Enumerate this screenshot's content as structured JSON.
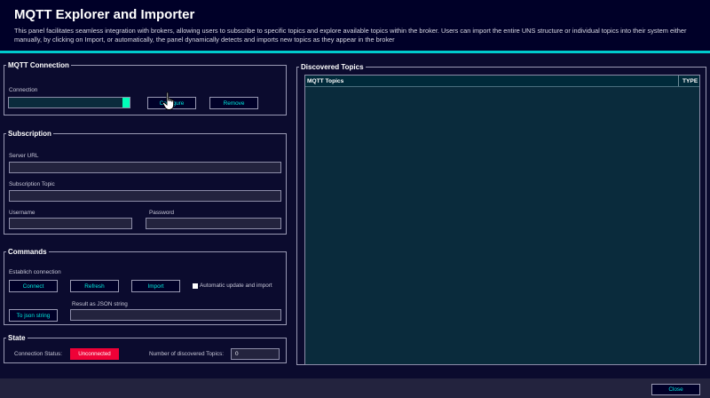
{
  "header": {
    "title": "MQTT Explorer and Importer",
    "description": "This panel facilitates seamless integration with brokers, allowing users to subscribe to specific topics and explore available topics within the broker. Users can import the entire UNS structure or individual topics into their system either manually, by clicking on Import, or automatically, the panel dynamically detects and imports new topics as they appear in the broker"
  },
  "mqtt_connection": {
    "legend": "MQTT Connection",
    "connection_label": "Connection",
    "connection_value": "",
    "configure_label": "Configure",
    "remove_label": "Remove"
  },
  "subscription": {
    "legend": "Subscription",
    "server_url_label": "Server URL",
    "server_url_value": "",
    "topic_label": "Subscription Topic",
    "topic_value": "",
    "username_label": "Username",
    "username_value": "",
    "password_label": "Password",
    "password_value": ""
  },
  "commands": {
    "legend": "Commands",
    "establish_label": "Establich connection",
    "connect_label": "Connect",
    "refresh_label": "Refresh",
    "import_label": "Import",
    "auto_update_label": "Automatic update and import",
    "auto_update_checked": false,
    "json_result_label": "Result as JSON string",
    "json_result_value": "",
    "to_json_label": "To json string"
  },
  "state": {
    "legend": "State",
    "status_label": "Connection Status:",
    "status_value": "Unconnected",
    "discovered_count_label": "Number of discovered Topics:",
    "discovered_count_value": "0"
  },
  "discovered_topics": {
    "legend": "Discovered Topics",
    "columns": [
      "MQTT Topics",
      "TYPE"
    ],
    "rows": []
  },
  "footer": {
    "close_label": "Close"
  },
  "colors": {
    "background": "#000028",
    "accent": "#00cccc",
    "button_text": "#00e6dc",
    "status_error": "#ef0137",
    "connection_indicator": "#00ffb9"
  },
  "icons": {
    "cursor": "hand-pointer-icon"
  }
}
